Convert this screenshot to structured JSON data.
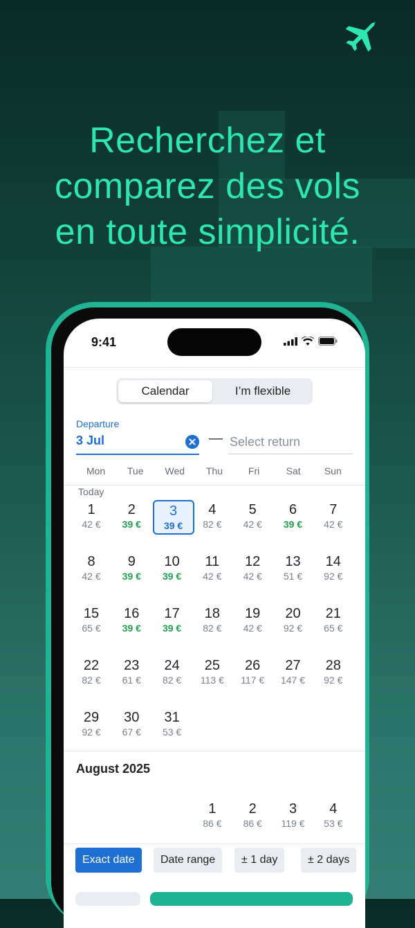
{
  "headline": {
    "lines": [
      "Recherchez et",
      "comparez des vols",
      "en toute simplicité."
    ]
  },
  "status_bar": {
    "time": "9:41"
  },
  "segmented": {
    "calendar": "Calendar",
    "flexible": "I’m flexible"
  },
  "departure": {
    "label": "Departure",
    "value": "3 Jul",
    "return_placeholder": "Select return"
  },
  "weekdays": [
    "Mon",
    "Tue",
    "Wed",
    "Thu",
    "Fri",
    "Sat",
    "Sun"
  ],
  "today_label": "Today",
  "july": {
    "days": [
      {
        "d": "1",
        "p": "42 €",
        "cheap": false
      },
      {
        "d": "2",
        "p": "39 €",
        "cheap": true
      },
      {
        "d": "3",
        "p": "39 €",
        "cheap": true,
        "selected": true
      },
      {
        "d": "4",
        "p": "82 €",
        "cheap": false
      },
      {
        "d": "5",
        "p": "42 €",
        "cheap": false
      },
      {
        "d": "6",
        "p": "39 €",
        "cheap": true
      },
      {
        "d": "7",
        "p": "42 €",
        "cheap": false
      },
      {
        "d": "8",
        "p": "42 €",
        "cheap": false
      },
      {
        "d": "9",
        "p": "39 €",
        "cheap": true
      },
      {
        "d": "10",
        "p": "39 €",
        "cheap": true
      },
      {
        "d": "11",
        "p": "42 €",
        "cheap": false
      },
      {
        "d": "12",
        "p": "42 €",
        "cheap": false
      },
      {
        "d": "13",
        "p": "51 €",
        "cheap": false
      },
      {
        "d": "14",
        "p": "92 €",
        "cheap": false
      },
      {
        "d": "15",
        "p": "65 €",
        "cheap": false
      },
      {
        "d": "16",
        "p": "39 €",
        "cheap": true
      },
      {
        "d": "17",
        "p": "39 €",
        "cheap": true
      },
      {
        "d": "18",
        "p": "82 €",
        "cheap": false
      },
      {
        "d": "19",
        "p": "42 €",
        "cheap": false
      },
      {
        "d": "20",
        "p": "92 €",
        "cheap": false
      },
      {
        "d": "21",
        "p": "65 €",
        "cheap": false
      },
      {
        "d": "22",
        "p": "82 €",
        "cheap": false
      },
      {
        "d": "23",
        "p": "61 €",
        "cheap": false
      },
      {
        "d": "24",
        "p": "82 €",
        "cheap": false
      },
      {
        "d": "25",
        "p": "113 €",
        "cheap": false
      },
      {
        "d": "26",
        "p": "117 €",
        "cheap": false
      },
      {
        "d": "27",
        "p": "147 €",
        "cheap": false
      },
      {
        "d": "28",
        "p": "92 €",
        "cheap": false
      },
      {
        "d": "29",
        "p": "92 €",
        "cheap": false
      },
      {
        "d": "30",
        "p": "67 €",
        "cheap": false
      },
      {
        "d": "31",
        "p": "53 €",
        "cheap": false
      }
    ]
  },
  "august": {
    "title": "August 2025",
    "days": [
      {
        "d": "1",
        "p": "86 €",
        "cheap": false
      },
      {
        "d": "2",
        "p": "86 €",
        "cheap": false
      },
      {
        "d": "3",
        "p": "119 €",
        "cheap": false
      },
      {
        "d": "4",
        "p": "53 €",
        "cheap": false
      }
    ]
  },
  "chips": {
    "exact": "Exact date",
    "range": "Date range",
    "one_day": "± 1 day",
    "two_days": "± 2 days"
  },
  "colors": {
    "accent": "#1d6fd1",
    "cheap": "#20a050",
    "brand": "#2ee6b0"
  }
}
